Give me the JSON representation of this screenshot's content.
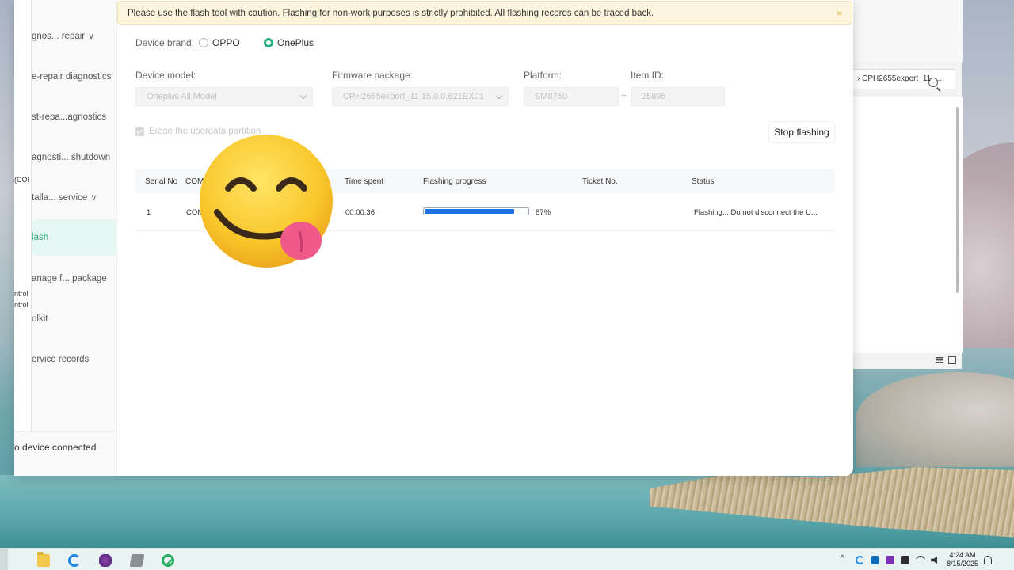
{
  "banner": {
    "text": "Please use the flash tool with caution. Flashing for non-work purposes is strictly prohibited. All flashing records can be traced back.",
    "close_icon": "×"
  },
  "sidebar": {
    "items": [
      {
        "label": "gnos... repair",
        "chevron": "∨"
      },
      {
        "label": "e-repair diagnostics"
      },
      {
        "label": "st-repa...agnostics"
      },
      {
        "label": "agnosti... shutdown"
      },
      {
        "label": "talla... service",
        "chevron": "∨"
      },
      {
        "label": "lash",
        "active": true
      },
      {
        "label": "anage f... package"
      },
      {
        "label": "olkit"
      },
      {
        "label": "ervice records"
      }
    ],
    "edge_texts": [
      "(COI",
      "ntrol",
      "ntrol"
    ],
    "footer": "o device connected"
  },
  "form": {
    "brand_label": "Device brand:",
    "brand_options": [
      {
        "label": "OPPO",
        "selected": false
      },
      {
        "label": "OnePlus",
        "selected": true
      }
    ],
    "model_label": "Device model:",
    "model_value": "Oneplus All Model",
    "firmware_label": "Firmware package:",
    "firmware_value": "CPH2655export_11 15.0.0.821EX01",
    "platform_label": "Platform:",
    "platform_value": "SM8750",
    "item_label": "Item ID:",
    "item_value": "25895",
    "range_sep": "~",
    "erase_label": "Erase the userdata partition",
    "erase_checked": true,
    "stop_button": "Stop flashing"
  },
  "table": {
    "headers": [
      "Serial No",
      "COM",
      "Time spent",
      "Flashing progress",
      "Ticket No.",
      "Status"
    ],
    "rows": [
      {
        "serial": "1",
        "com": "COM",
        "time": "00:00:36",
        "progress": 0.87,
        "progress_label": "87%",
        "ticket": "",
        "status": "Flashing... Do not disconnect the U..."
      }
    ]
  },
  "background_window": {
    "address_text": "› CPH2655export_11_..."
  },
  "taskbar": {
    "time": "4:24 AM",
    "date": "8/15/2025",
    "tray_chevron": "^"
  },
  "colors": {
    "accent": "#2bb07f",
    "banner_bg": "#fdf5dd",
    "progress_fill": "#1a73e8"
  }
}
